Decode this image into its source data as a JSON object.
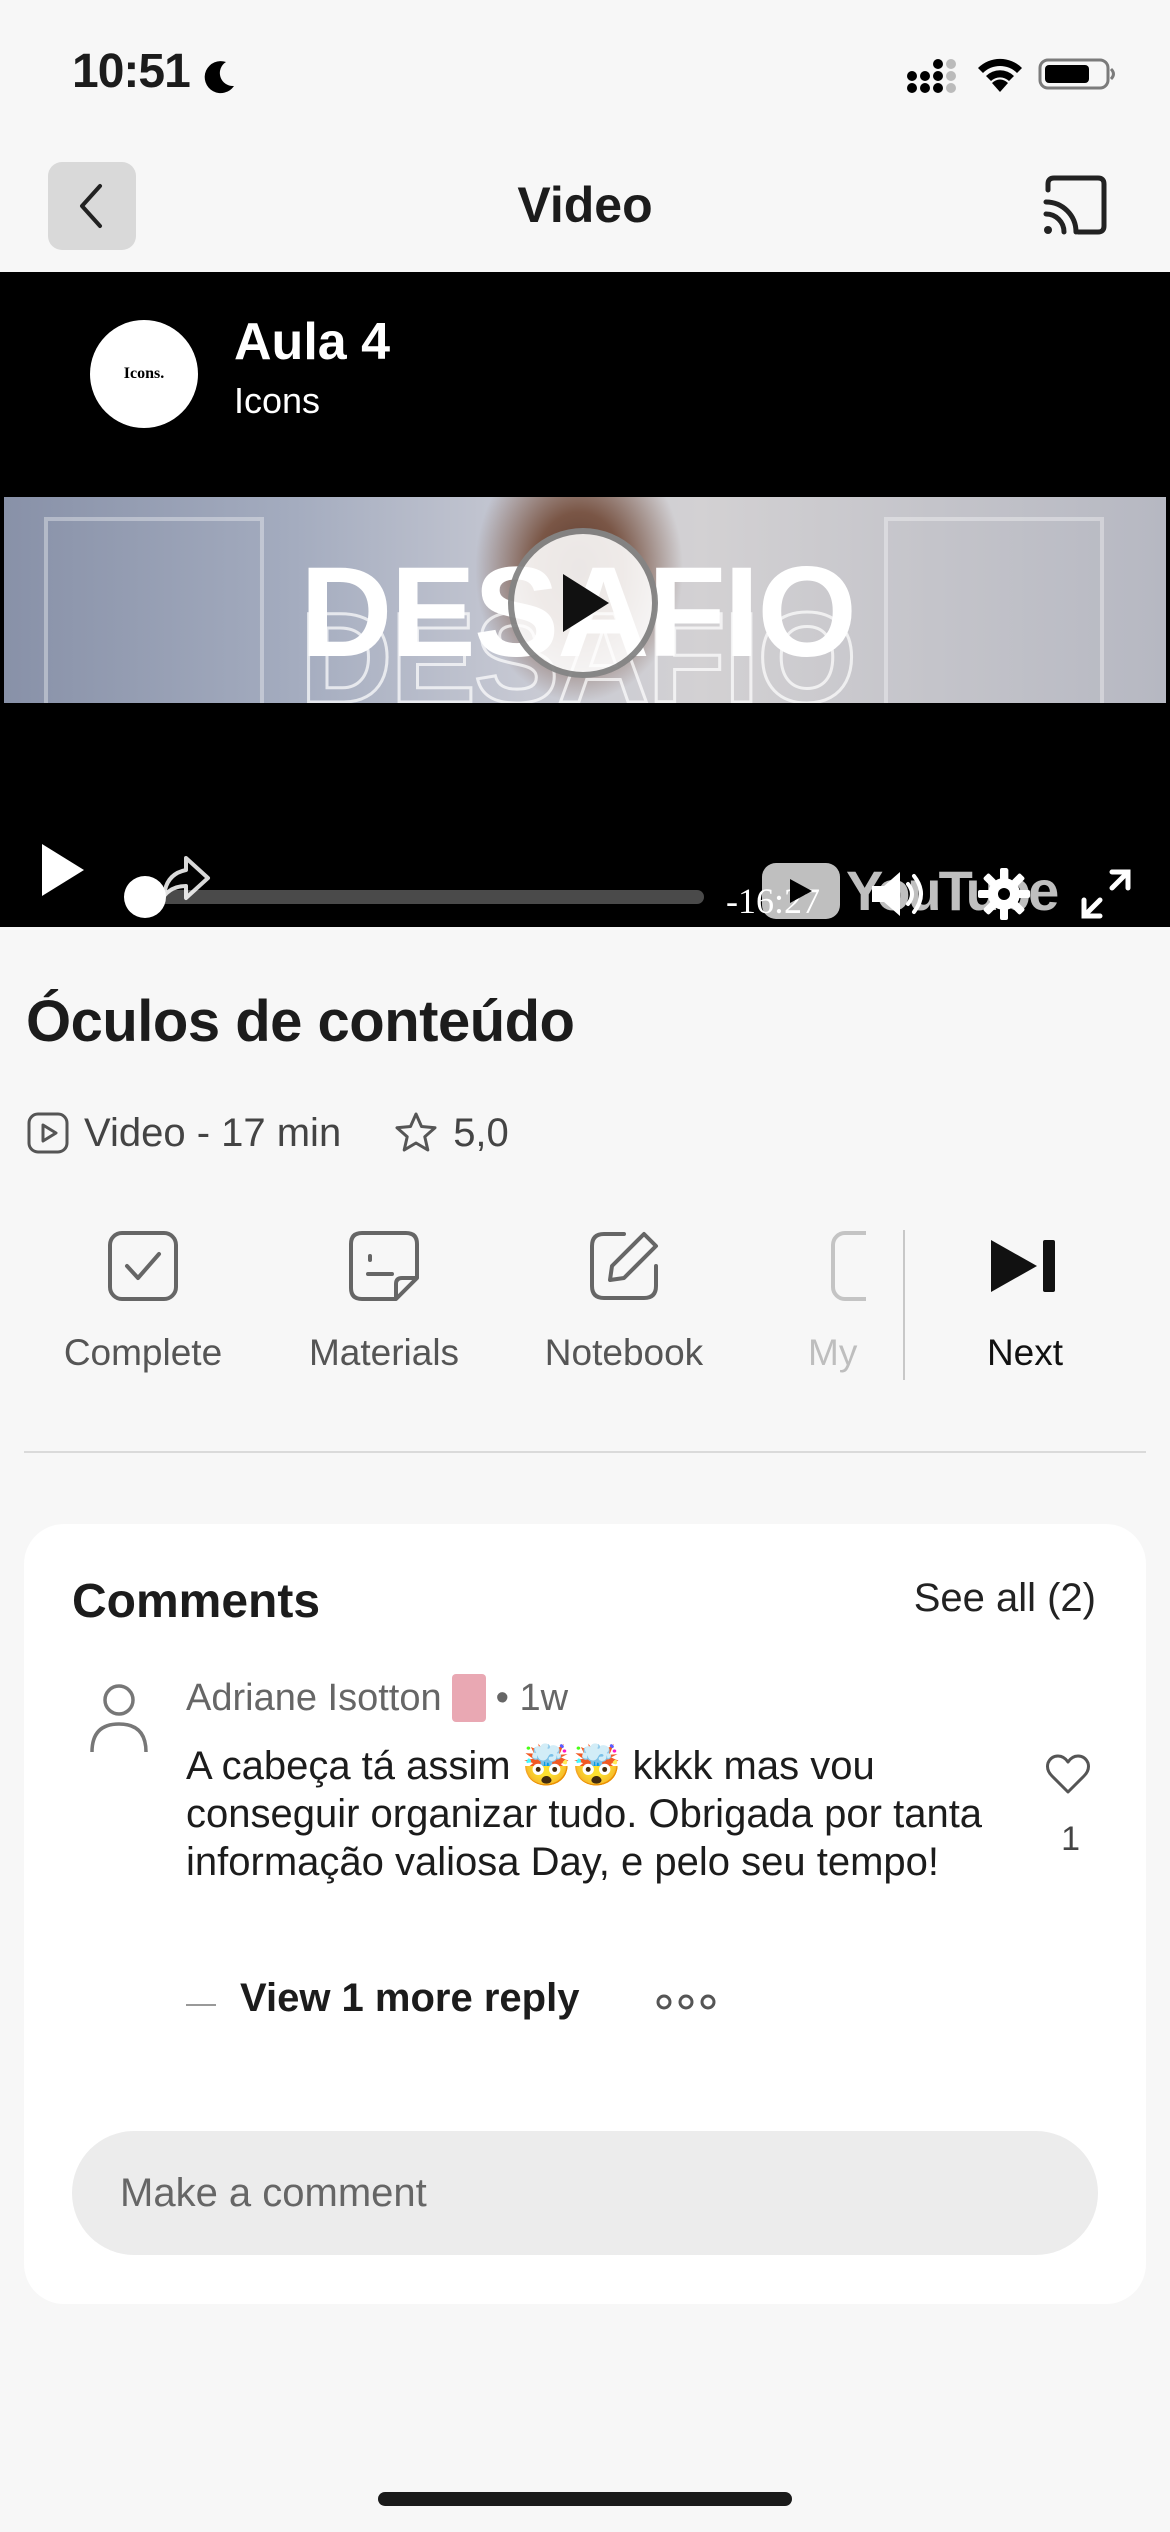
{
  "status_bar": {
    "time": "10:51"
  },
  "nav": {
    "title": "Video"
  },
  "video": {
    "title": "Aula 4",
    "channel": "Icons",
    "channel_logo_text": "Icons.",
    "thumbnail_text": "DESAFIO",
    "time_remaining": "-16:27",
    "youtube_label": "YouTube",
    "progress": 0.02
  },
  "lesson": {
    "title": "Óculos de conteúdo",
    "type_label": "Video - 17 min",
    "rating": "5,0"
  },
  "actions": [
    {
      "label": "Complete"
    },
    {
      "label": "Materials"
    },
    {
      "label": "Notebook"
    },
    {
      "label": "My"
    }
  ],
  "next_label": "Next",
  "comments": {
    "title": "Comments",
    "see_all": "See all (2)",
    "items": [
      {
        "author": "Adriane Isotton",
        "age": "• 1w",
        "text": "A cabeça tá assim 🤯🤯 kkkk mas vou conseguir organizar tudo. Obrigada por tanta informação valiosa Day, e pelo seu tempo!",
        "likes": "1",
        "view_replies": "View 1 more reply"
      }
    ],
    "input_placeholder": "Make a comment"
  },
  "colors": {
    "background": "#f7f7f7",
    "player_bg": "#000000",
    "card_bg": "#ffffff",
    "input_bg": "#ececec"
  }
}
